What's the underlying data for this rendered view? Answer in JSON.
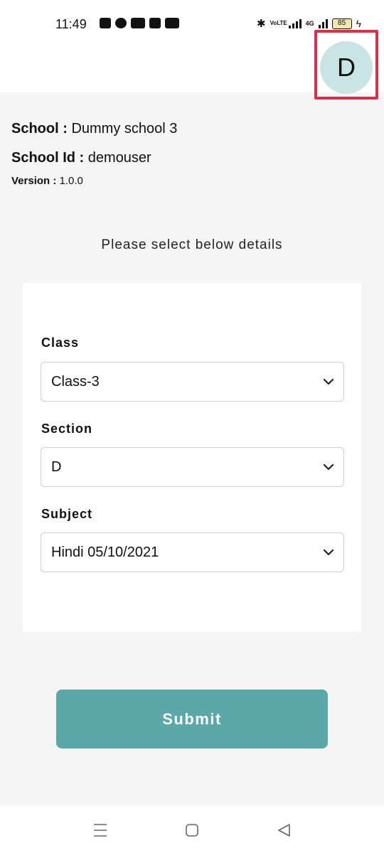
{
  "status_bar": {
    "time": "11:49",
    "battery": "85",
    "volte": "VoLTE",
    "network": "4G"
  },
  "header": {
    "avatar_letter": "D"
  },
  "info": {
    "school_label": "School :",
    "school_value": "Dummy school 3",
    "id_label": "School Id :",
    "id_value": "demouser",
    "version_label": "Version :",
    "version_value": "1.0.0"
  },
  "instruction": "Please select below details",
  "form": {
    "class_label": "Class",
    "class_value": "Class-3",
    "section_label": "Section",
    "section_value": "D",
    "subject_label": "Subject",
    "subject_value": "Hindi 05/10/2021"
  },
  "submit_label": "Submit",
  "colors": {
    "accent": "#5ba8a8",
    "avatar_bg": "#c9e4e4",
    "highlight": "#d9304a"
  }
}
